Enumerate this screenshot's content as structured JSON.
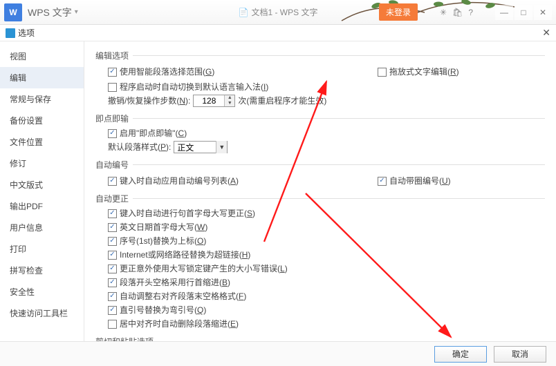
{
  "titlebar": {
    "logo_letter": "W",
    "app_name": "WPS 文字",
    "doc_title": "文档1 - WPS 文字",
    "login_label": "未登录"
  },
  "dialog": {
    "title": "选项"
  },
  "sidebar": {
    "items": [
      "视图",
      "编辑",
      "常规与保存",
      "备份设置",
      "文件位置",
      "修订",
      "中文版式",
      "输出PDF",
      "用户信息",
      "打印",
      "拼写检查",
      "安全性",
      "快速访问工具栏"
    ],
    "active_index": 1
  },
  "sections": {
    "edit_options": {
      "title": "编辑选项",
      "smart_paragraph": {
        "checked": true,
        "label_pre": "使用智能段落选择范围(",
        "hot": "G",
        "label_post": ")"
      },
      "drag_text": {
        "checked": false,
        "label_pre": "拖放式文字编辑(",
        "hot": "R",
        "label_post": ")"
      },
      "auto_switch_ime": {
        "checked": false,
        "label_pre": "程序启动时自动切换到默认语言输入法(",
        "hot": "I",
        "label_post": ")"
      },
      "undo": {
        "label_pre": "撤销/恢复操作步数(",
        "hot": "N",
        "label_post": "):",
        "value": "128",
        "suffix": "次(需重启程序才能生效)"
      }
    },
    "click_type": {
      "title": "即点即输",
      "enable": {
        "checked": true,
        "label_pre": "启用\"即点即输\"(",
        "hot": "C",
        "label_post": ")"
      },
      "default_style": {
        "label_pre": "默认段落样式(",
        "hot": "P",
        "label_post": "):",
        "value": "正文"
      }
    },
    "auto_number": {
      "title": "自动编号",
      "apply_list": {
        "checked": true,
        "label_pre": "键入时自动应用自动编号列表(",
        "hot": "A",
        "label_post": ")"
      },
      "circle_number": {
        "checked": true,
        "label_pre": "自动带圈编号(",
        "hot": "U",
        "label_post": ")"
      }
    },
    "auto_correct": {
      "title": "自动更正",
      "items": [
        {
          "checked": true,
          "label_pre": "键入时自动进行句首字母大写更正(",
          "hot": "S",
          "label_post": ")"
        },
        {
          "checked": true,
          "label_pre": "英文日期首字母大写(",
          "hot": "W",
          "label_post": ")"
        },
        {
          "checked": true,
          "label_pre": "序号(1st)替换为上标(",
          "hot": "O",
          "label_post": ")"
        },
        {
          "checked": true,
          "label_pre": "Internet或网络路径替换为超链接(",
          "hot": "H",
          "label_post": ")"
        },
        {
          "checked": true,
          "label_pre": "更正意外使用大写锁定键产生的大小写错误(",
          "hot": "L",
          "label_post": ")"
        },
        {
          "checked": true,
          "label_pre": "段落开头空格采用行首缩进(",
          "hot": "B",
          "label_post": ")"
        },
        {
          "checked": true,
          "label_pre": "自动调整右对齐段落末空格格式(",
          "hot": "F",
          "label_post": ")"
        },
        {
          "checked": true,
          "label_pre": "直引号替换为弯引号(",
          "hot": "Q",
          "label_post": ")"
        },
        {
          "checked": false,
          "label_pre": "居中对齐时自动删除段落缩进(",
          "hot": "E",
          "label_post": ")"
        }
      ]
    },
    "cut_paste": {
      "title": "剪切和粘贴选项"
    }
  },
  "footer": {
    "ok": "确定",
    "cancel": "取消"
  }
}
